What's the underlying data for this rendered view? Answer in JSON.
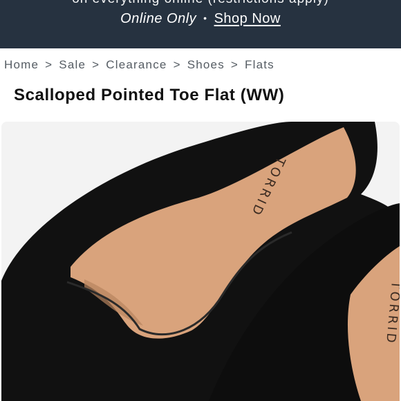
{
  "promo": {
    "headline_cut": "on everything online (restrictions apply)",
    "channel": "Online Only",
    "separator": "•",
    "cta": "Shop Now"
  },
  "breadcrumb": {
    "items": [
      "Home",
      "Sale",
      "Clearance",
      "Shoes",
      "Flats"
    ],
    "separator": ">"
  },
  "product": {
    "title": "Scalloped Pointed Toe Flat (WW)",
    "image_brand_text": "TORRID",
    "image_alt": "Black pointed toe flat with tan footbed"
  },
  "colors": {
    "banner": "#263240",
    "shoe": "#111111",
    "footbed": "#d9a37c",
    "background": "#f3f3f3"
  }
}
